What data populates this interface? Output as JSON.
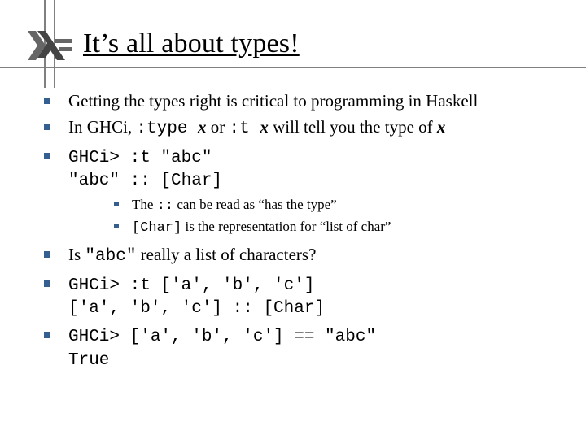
{
  "title": "It’s all about types!",
  "bullets": [
    {
      "text": "Getting the types right is critical to programming in Haskell"
    },
    {
      "seg1": "In GHCi, ",
      "code1": ":type ",
      "var1": "x",
      "seg2": " or ",
      "code2": ":t ",
      "var2": "x",
      "seg3": " will tell you the type of ",
      "var3": "x"
    },
    {
      "line1": "GHCi> :t \"abc\"",
      "line2": "\"abc\" :: [Char]",
      "sub": [
        {
          "seg1": "The ",
          "code": "::",
          "seg2": " can be read as “has the type”"
        },
        {
          "code": "[Char]",
          "seg": " is the representation for “list of char”"
        }
      ]
    },
    {
      "seg1": "Is ",
      "code": "\"abc\"",
      "seg2": " really a list of characters?"
    },
    {
      "line1": "GHCi> :t ['a', 'b', 'c']",
      "line2": "['a', 'b', 'c'] :: [Char]"
    },
    {
      "line1": "GHCi> ['a', 'b', 'c'] == \"abc\"",
      "line2": "True"
    }
  ]
}
